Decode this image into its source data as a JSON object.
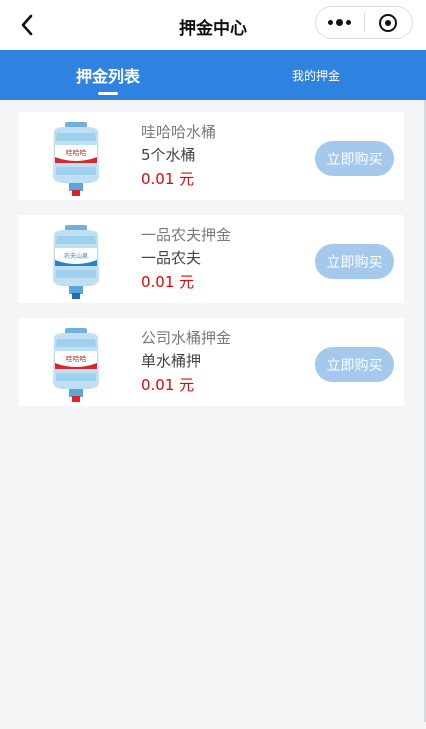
{
  "navbar": {
    "title": "押金中心",
    "back_icon": "chevron-left-icon",
    "more_icon": "more-dots-icon",
    "close_icon": "target-icon"
  },
  "tabs": [
    {
      "label": "押金列表",
      "active": true
    },
    {
      "label": "我的押金",
      "active": false
    }
  ],
  "colors": {
    "tab_bar": "#2f83e0",
    "price": "#f00000",
    "buy_button": "#a4c9ec",
    "page_bg": "#f4f5f7"
  },
  "items": [
    {
      "title": "哇哈哈水桶",
      "subtitle": "5个水桶",
      "price": "0.01 元",
      "button": "立即购买",
      "brand": "哇哈哈",
      "band": "#d9262b"
    },
    {
      "title": "一品农夫押金",
      "subtitle": "一品农夫",
      "price": "0.01 元",
      "button": "立即购买",
      "brand": "农夫山泉",
      "band": "#2a82c9"
    },
    {
      "title": "公司水桶押金",
      "subtitle": "单水桶押",
      "price": "0.01 元",
      "button": "立即购买",
      "brand": "哇哈哈",
      "band": "#d9262b"
    }
  ]
}
